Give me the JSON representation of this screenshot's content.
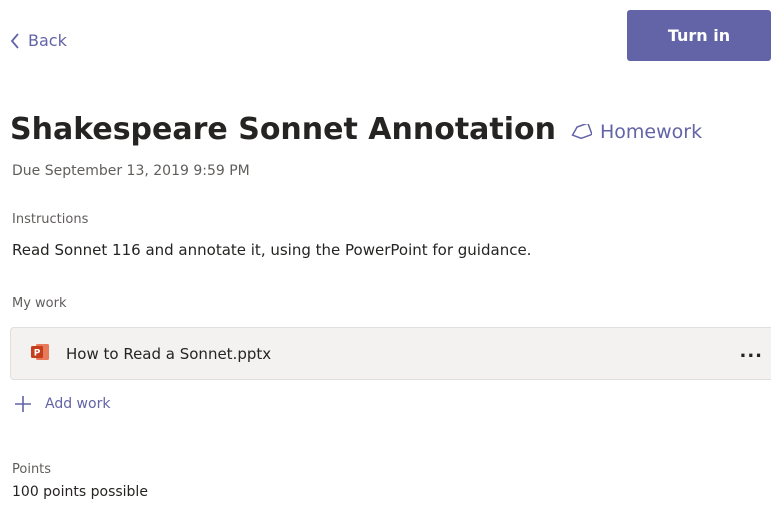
{
  "nav": {
    "back_label": "Back"
  },
  "actions": {
    "turn_in_label": "Turn in"
  },
  "assignment": {
    "title": "Shakespeare Sonnet Annotation",
    "category": "Homework",
    "due": "Due September 13, 2019 9:59 PM",
    "instructions_label": "Instructions",
    "instructions_text": "Read Sonnet 116 and annotate it, using the PowerPoint for guidance."
  },
  "my_work": {
    "label": "My work",
    "files": [
      {
        "name": "How to Read a Sonnet.pptx",
        "icon": "powerpoint-file-icon",
        "more_label": "..."
      }
    ],
    "add_work_label": "Add work"
  },
  "points": {
    "label": "Points",
    "value": "100 points possible"
  },
  "colors": {
    "accent": "#6264a7",
    "text": "#252423",
    "secondary_text": "#605e5c",
    "card_background": "#f3f2f1",
    "powerpoint": "#c43e1c"
  }
}
